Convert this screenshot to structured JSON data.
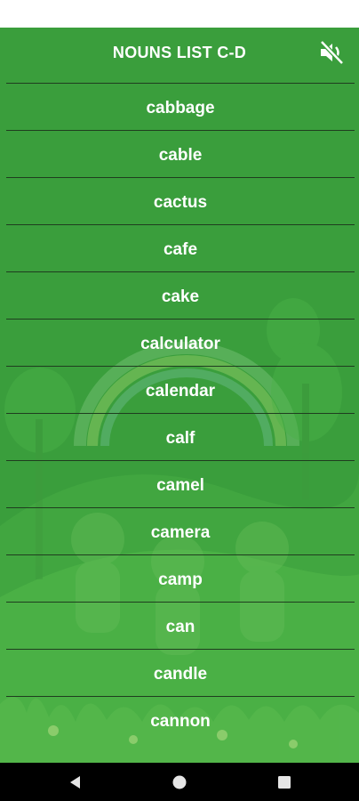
{
  "header": {
    "title": "NOUNS LIST C-D",
    "mute_icon": "volume-muted-icon"
  },
  "words": [
    "cabbage",
    "cable",
    "cactus",
    "cafe",
    "cake",
    "calculator",
    "calendar",
    "calf",
    "camel",
    "camera",
    "camp",
    "can",
    "candle",
    "cannon"
  ],
  "nav": {
    "back_icon": "back-triangle-icon",
    "home_icon": "home-circle-icon",
    "recents_icon": "recents-square-icon"
  },
  "colors": {
    "background": "#3a9e3c",
    "divider": "#1f3d1f",
    "text": "#ffffff"
  }
}
